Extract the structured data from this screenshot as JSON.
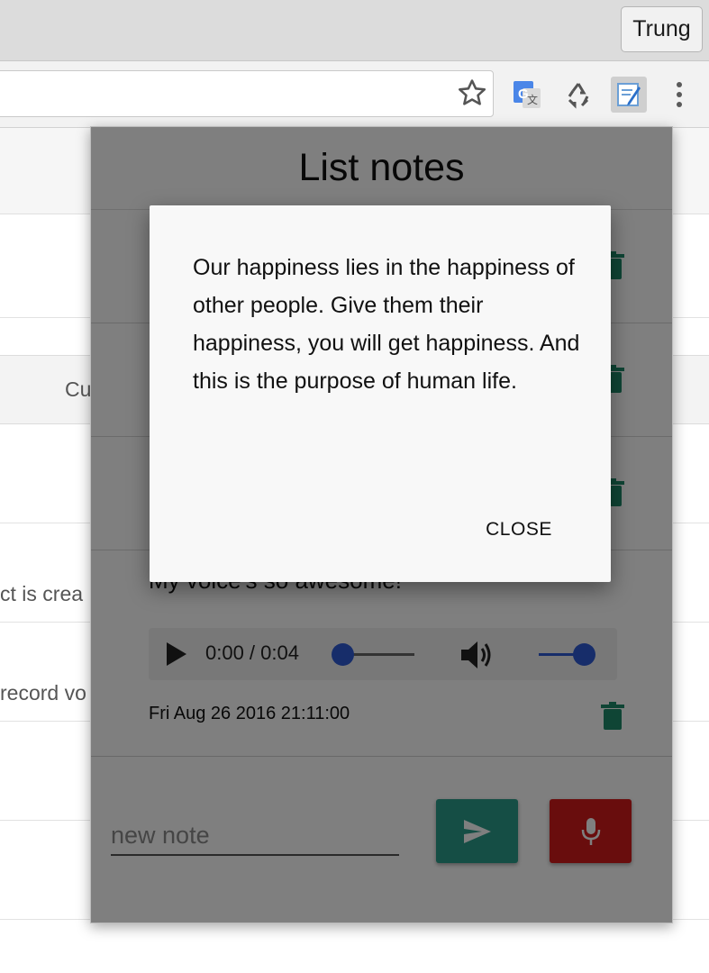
{
  "browser": {
    "profile_name": "Trung",
    "extensions": [
      "google-translate-icon",
      "recycle-icon",
      "notes-extension-icon"
    ]
  },
  "page_behind": {
    "fragments": [
      "Cu",
      "ct is crea",
      "record vo"
    ]
  },
  "popup": {
    "title": "List notes",
    "notes": [
      {
        "title": "My voice's so awesome!",
        "audio_time": "0:00 / 0:04",
        "date": "Fri Aug 26 2016 21:11:00"
      }
    ],
    "composer": {
      "placeholder": "new note",
      "send_button": "send-icon",
      "mic_button": "mic-icon",
      "send_color": "#2a9d8a",
      "mic_color": "#d21a1a"
    }
  },
  "dialog": {
    "text": "Our happiness lies in the happiness of other people. Give them their happiness, you will get happiness. And this is the purpose of human life.",
    "close_label": "CLOSE"
  }
}
